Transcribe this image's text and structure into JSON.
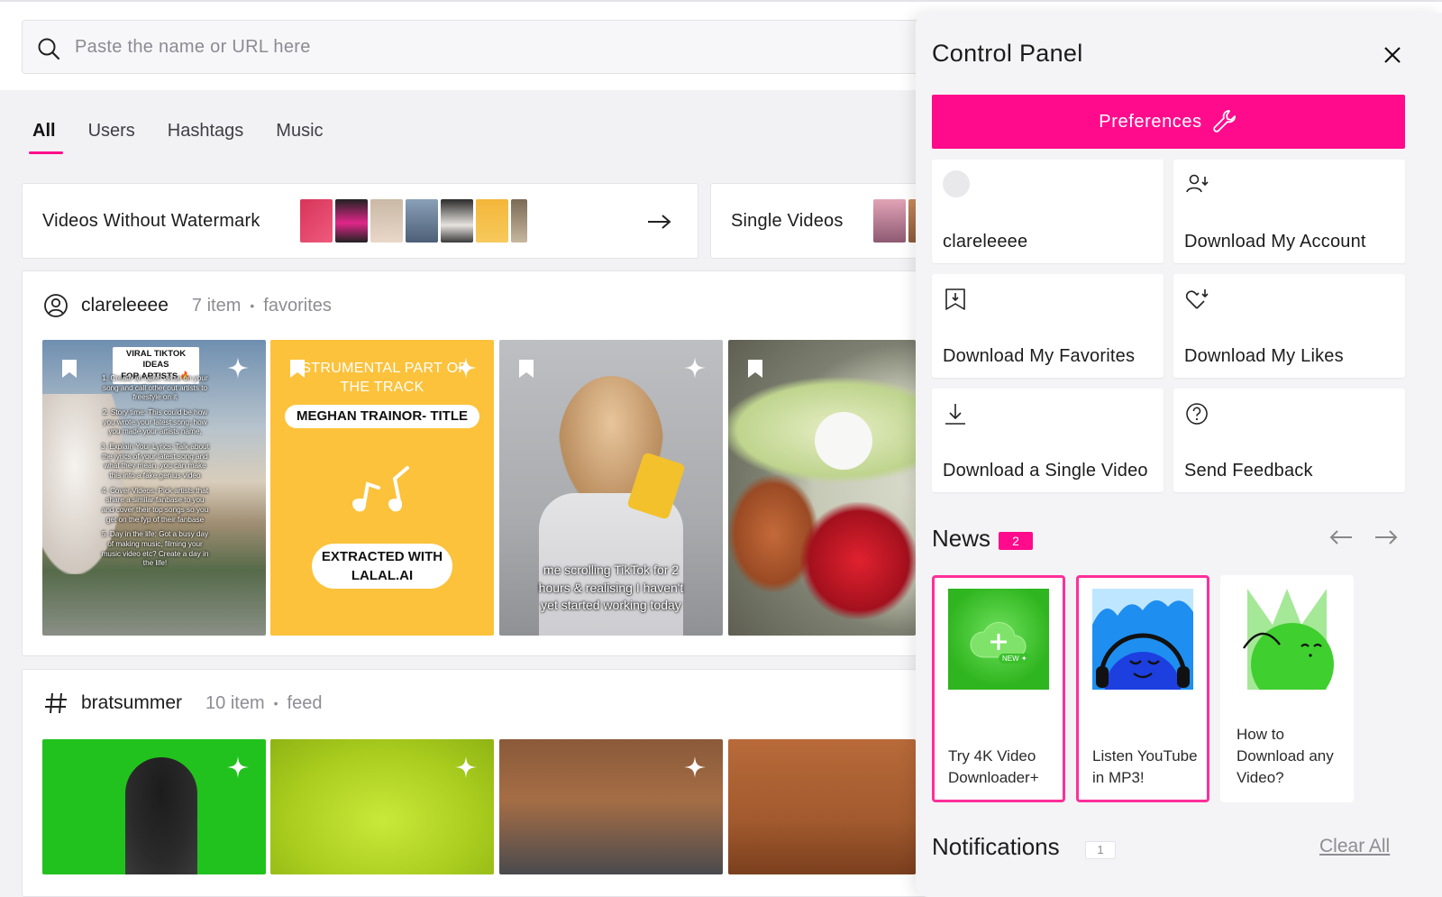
{
  "search": {
    "placeholder": "Paste the name or URL here",
    "icon": "search-icon"
  },
  "tabs": [
    {
      "label": "All",
      "active": true
    },
    {
      "label": "Users",
      "active": false
    },
    {
      "label": "Hashtags",
      "active": false
    },
    {
      "label": "Music",
      "active": false
    }
  ],
  "featured": [
    {
      "title": "Videos Without Watermark"
    },
    {
      "title": "Single Videos"
    }
  ],
  "sections": [
    {
      "icon": "user-circle-icon",
      "name": "clareleeee",
      "count": "7 item",
      "type": "favorites",
      "videos": [
        {
          "overlay_lines": [
            "VIRAL TIKTOK IDEAS",
            "FOR ARTISTS 🔥",
            "1. Create an open verse on your song and call other out artists to freestyle on it",
            "2. Story time: This could be how you wrote your latest song, how you made your artists name,",
            "3. Explain Your Lyrics: Talk about the lyrics of your latest song and what they mean, you can make this into a fake genius video",
            "4. Cover Videos: Pick artists that share a similar fanbase to you and cover their top songs so you get on the fyp of their fanbase",
            "5. Day in the life: Got a busy day of making music, filming your music video etc? Create a day in the life!"
          ]
        },
        {
          "overlay_lines": [
            "ISTRUMENTAL PART OF",
            "THE TRACK",
            "MEGHAN TRAINOR- TITLE",
            "EXTRACTED WITH",
            "LALAL.AI"
          ]
        },
        {
          "overlay_lines": [
            "me scrolling TikTok for 2",
            "hours & realising I haven't",
            "yet started working today"
          ]
        },
        {
          "overlay_lines": []
        }
      ]
    },
    {
      "icon": "hashtag-icon",
      "name": "bratsummer",
      "count": "10 item",
      "type": "feed"
    }
  ],
  "panel": {
    "title": "Control Panel",
    "preferences_label": "Preferences",
    "tiles": [
      {
        "label": "clareleeee",
        "icon": "avatar-placeholder"
      },
      {
        "label": "Download My Account",
        "icon": "user-download-icon"
      },
      {
        "label": "Download My Favorites",
        "icon": "bookmark-download-icon"
      },
      {
        "label": "Download My Likes",
        "icon": "heart-download-icon"
      },
      {
        "label": "Download a Single Video",
        "icon": "download-icon"
      },
      {
        "label": "Send Feedback",
        "icon": "question-bubble-icon"
      }
    ],
    "news": {
      "title": "News",
      "badge": "2",
      "items": [
        {
          "label": "Try 4K Video Downloader+",
          "highlighted": true,
          "img_label": "NEW ✦"
        },
        {
          "label": "Listen YouTube in MP3!",
          "highlighted": true
        },
        {
          "label": "How to Download any Video?",
          "highlighted": false
        }
      ]
    },
    "notifications": {
      "title": "Notifications",
      "badge": "1",
      "clear_label": "Clear All"
    }
  },
  "colors": {
    "accent": "#ff0b8c",
    "background": "#f2f2f4"
  }
}
